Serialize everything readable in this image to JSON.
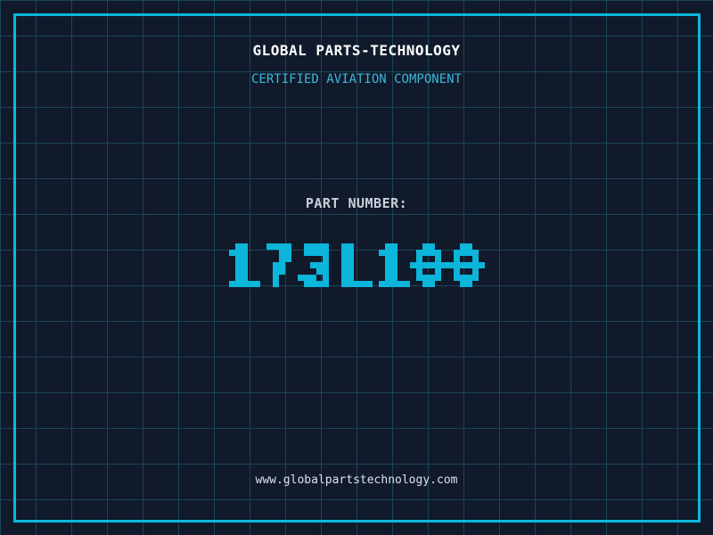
{
  "theme": {
    "background": "#101a2b",
    "grid_line_color": "#1d4457",
    "frame_color": "#0db7db",
    "title_color": "#ffffff",
    "subtitle_color": "#3ab8d8",
    "label_color": "#c9cfd8",
    "part_number_color": "#0cb5da",
    "url_color": "#dde2e8"
  },
  "header": {
    "title": "GLOBAL PARTS-TECHNOLOGY",
    "subtitle": "CERTIFIED AVIATION COMPONENT"
  },
  "part": {
    "label": "PART NUMBER:",
    "number": "173L100"
  },
  "footer": {
    "url": "www.globalpartstechnology.com"
  }
}
